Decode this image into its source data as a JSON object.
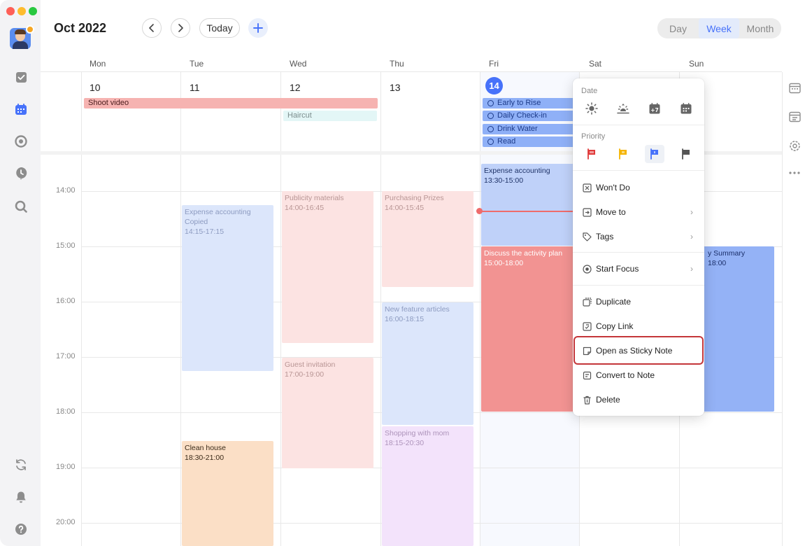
{
  "header": {
    "title": "Oct 2022",
    "today_label": "Today",
    "views": [
      "Day",
      "Week",
      "Month"
    ],
    "active_view": "Week"
  },
  "days": [
    {
      "name": "Mon",
      "num": "10"
    },
    {
      "name": "Tue",
      "num": "11"
    },
    {
      "name": "Wed",
      "num": "12"
    },
    {
      "name": "Thu",
      "num": "13"
    },
    {
      "name": "Fri",
      "num": "14"
    },
    {
      "name": "Sat",
      "num": ""
    },
    {
      "name": "Sun",
      "num": ""
    }
  ],
  "times": [
    "14:00",
    "15:00",
    "16:00",
    "17:00",
    "18:00",
    "19:00",
    "20:00"
  ],
  "allday": {
    "shoot_video": "Shoot video",
    "haircut": "Haircut",
    "fri_tasks": [
      "Early to Rise",
      "Daily Check-in",
      "Drink Water",
      "Read"
    ]
  },
  "events": {
    "tue_expense": {
      "title": "Expense accounting",
      "sub": "Copied",
      "time": "14:15-17:15"
    },
    "tue_clean": {
      "title": "Clean house",
      "time": "18:30-21:00"
    },
    "wed_publicity": {
      "title": "Publicity materials",
      "time": "14:00-16:45"
    },
    "wed_guest": {
      "title": "Guest invitation",
      "time": "17:00-19:00"
    },
    "thu_prizes": {
      "title": "Purchasing Prizes",
      "time": "14:00-15:45"
    },
    "thu_articles": {
      "title": "New feature articles",
      "time": "16:00-18:15"
    },
    "thu_shopping": {
      "title": "Shopping with mom",
      "time": "18:15-20:30"
    },
    "fri_expense": {
      "title": "Expense accounting",
      "time": "13:30-15:00"
    },
    "fri_discuss": {
      "title": "Discuss the activity plan",
      "time": "15:00-18:00"
    },
    "sun_summary": {
      "title": "y Summary",
      "time": "18:00"
    }
  },
  "menu": {
    "date_label": "Date",
    "priority_label": "Priority",
    "items": {
      "wont_do": "Won't Do",
      "move_to": "Move to",
      "tags": "Tags",
      "start_focus": "Start Focus",
      "duplicate": "Duplicate",
      "copy_link": "Copy Link",
      "sticky_note": "Open as Sticky Note",
      "convert_note": "Convert to Note",
      "delete": "Delete"
    }
  },
  "colors": {
    "accent": "#4772fa",
    "highlight": "#c4363a",
    "priority_high": "#e03b3b",
    "priority_medium": "#f5b400",
    "priority_low": "#4772fa",
    "priority_none": "#555555"
  }
}
